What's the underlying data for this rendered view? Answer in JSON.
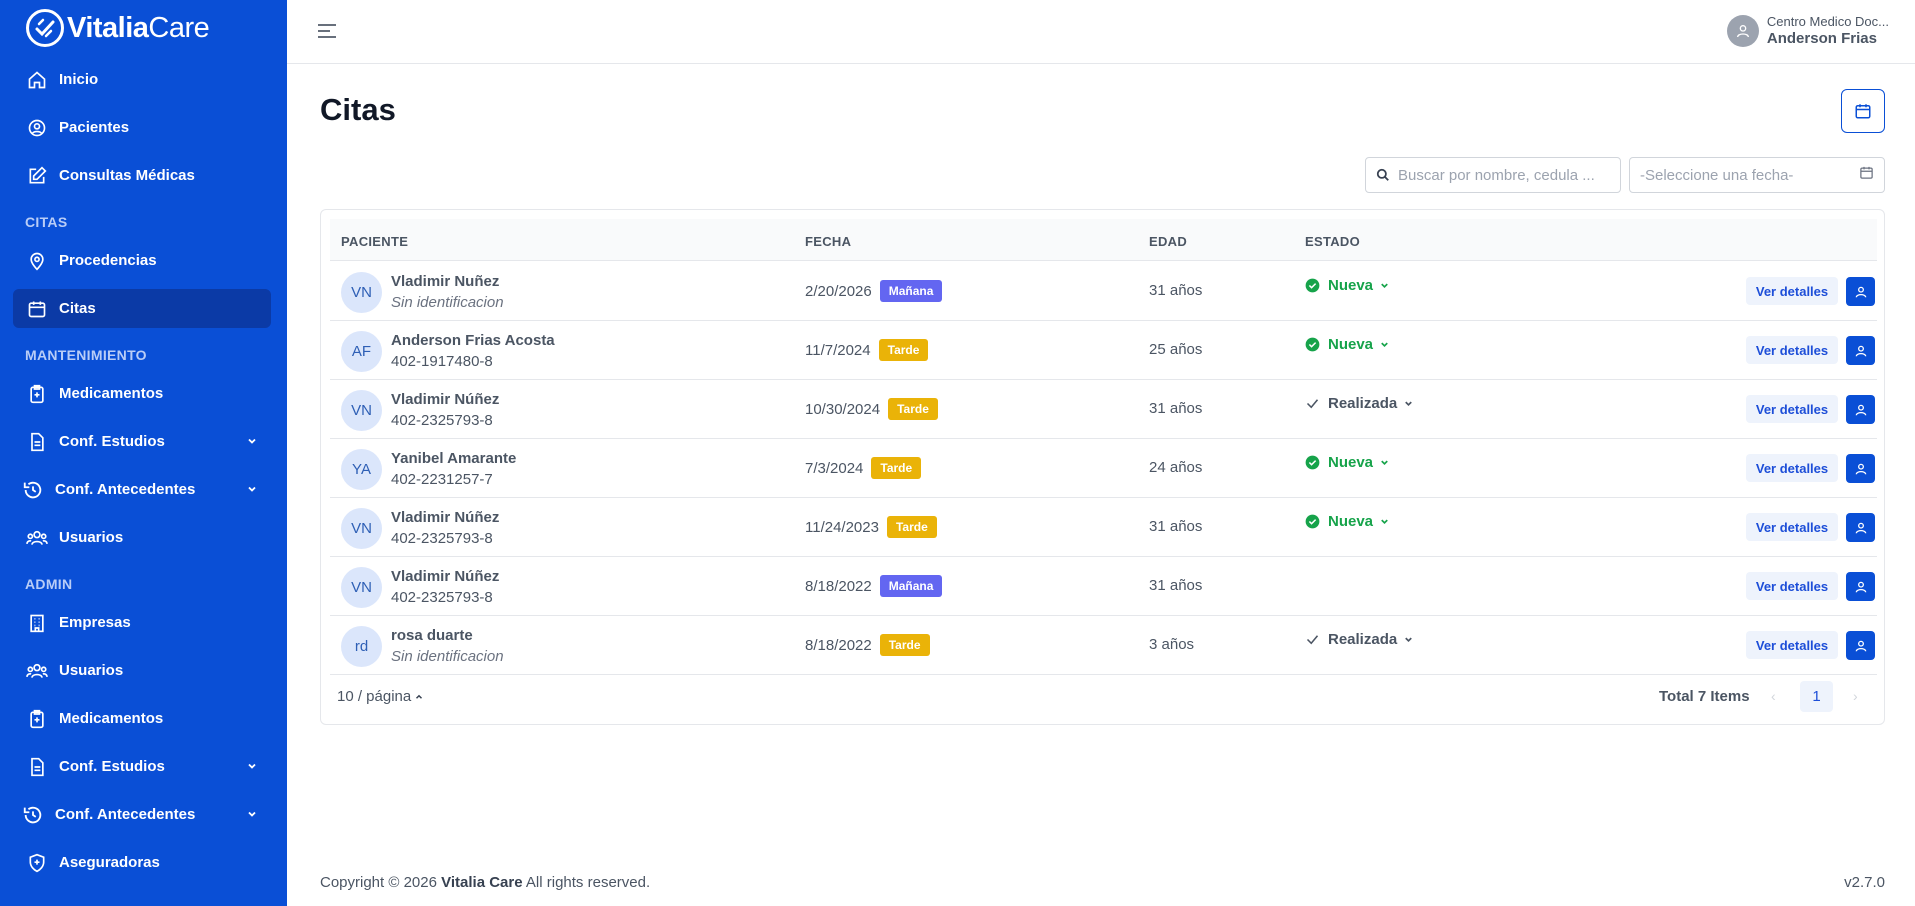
{
  "brand": {
    "name_bold": "Vitalia",
    "name_light": "Care"
  },
  "sidebar": {
    "items": [
      {
        "label": "Inicio",
        "icon": "home-icon"
      },
      {
        "label": "Pacientes",
        "icon": "user-circle-icon"
      },
      {
        "label": "Consultas Médicas",
        "icon": "edit-icon"
      },
      {
        "label": "Procedencias",
        "icon": "map-pin-icon"
      },
      {
        "label": "Citas",
        "icon": "calendar-icon",
        "active": true
      },
      {
        "label": "Medicamentos",
        "icon": "clipboard-plus-icon"
      },
      {
        "label": "Conf. Estudios",
        "icon": "document-icon"
      },
      {
        "label": "Conf. Antecedentes",
        "icon": "history-icon"
      },
      {
        "label": "Usuarios",
        "icon": "users-icon"
      },
      {
        "label": "Empresas",
        "icon": "building-icon"
      },
      {
        "label": "Usuarios",
        "icon": "users-icon"
      },
      {
        "label": "Medicamentos",
        "icon": "clipboard-plus-icon"
      },
      {
        "label": "Conf. Estudios",
        "icon": "document-icon"
      },
      {
        "label": "Conf. Antecedentes",
        "icon": "history-icon"
      },
      {
        "label": "Aseguradoras",
        "icon": "shield-icon"
      }
    ],
    "sections": [
      "CITAS",
      "MANTENIMIENTO",
      "ADMIN"
    ]
  },
  "header": {
    "org": "Centro Medico Doc...",
    "user": "Anderson Frias"
  },
  "main": {
    "title": "Citas",
    "search_placeholder": "Buscar por nombre, cedula ...",
    "date_placeholder": "-Seleccione una fecha-",
    "columns": [
      "PACIENTE",
      "FECHA",
      "EDAD",
      "ESTADO"
    ],
    "rows": [
      {
        "initials": "VN",
        "name": "Vladimir Nuñez",
        "id": "Sin identificacion",
        "noid": true,
        "date": "2/20/2026",
        "shift": "Mañana",
        "age": "31 años",
        "status": "Nueva"
      },
      {
        "initials": "AF",
        "name": "Anderson Frias Acosta",
        "id": "402-1917480-8",
        "noid": false,
        "date": "11/7/2024",
        "shift": "Tarde",
        "age": "25 años",
        "status": "Nueva"
      },
      {
        "initials": "VN",
        "name": "Vladimir Núñez",
        "id": "402-2325793-8",
        "noid": false,
        "date": "10/30/2024",
        "shift": "Tarde",
        "age": "31 años",
        "status": "Realizada"
      },
      {
        "initials": "YA",
        "name": "Yanibel Amarante",
        "id": "402-2231257-7",
        "noid": false,
        "date": "7/3/2024",
        "shift": "Tarde",
        "age": "24 años",
        "status": "Nueva"
      },
      {
        "initials": "VN",
        "name": "Vladimir Núñez",
        "id": "402-2325793-8",
        "noid": false,
        "date": "11/24/2023",
        "shift": "Tarde",
        "age": "31 años",
        "status": "Nueva"
      },
      {
        "initials": "VN",
        "name": "Vladimir Núñez",
        "id": "402-2325793-8",
        "noid": false,
        "date": "8/18/2022",
        "shift": "Mañana",
        "age": "31 años",
        "status": ""
      },
      {
        "initials": "rd",
        "name": "rosa duarte",
        "id": "Sin identificacion",
        "noid": true,
        "date": "8/18/2022",
        "shift": "Tarde",
        "age": "3 años",
        "status": "Realizada"
      }
    ],
    "details_label": "Ver detalles",
    "per_page": "10 / página",
    "total": "Total 7 Items",
    "current_page": "1"
  },
  "footer": {
    "copy_prefix": "Copyright © 2026 ",
    "copy_brand": "Vitalia Care",
    "copy_suffix": " All rights reserved.",
    "version": "v2.7.0"
  },
  "colors": {
    "sidebar": "#0a4fd6",
    "active": "#0b3aa6",
    "nueva": "#16a34a",
    "manana": "#6366f1",
    "tarde": "#eab308"
  }
}
